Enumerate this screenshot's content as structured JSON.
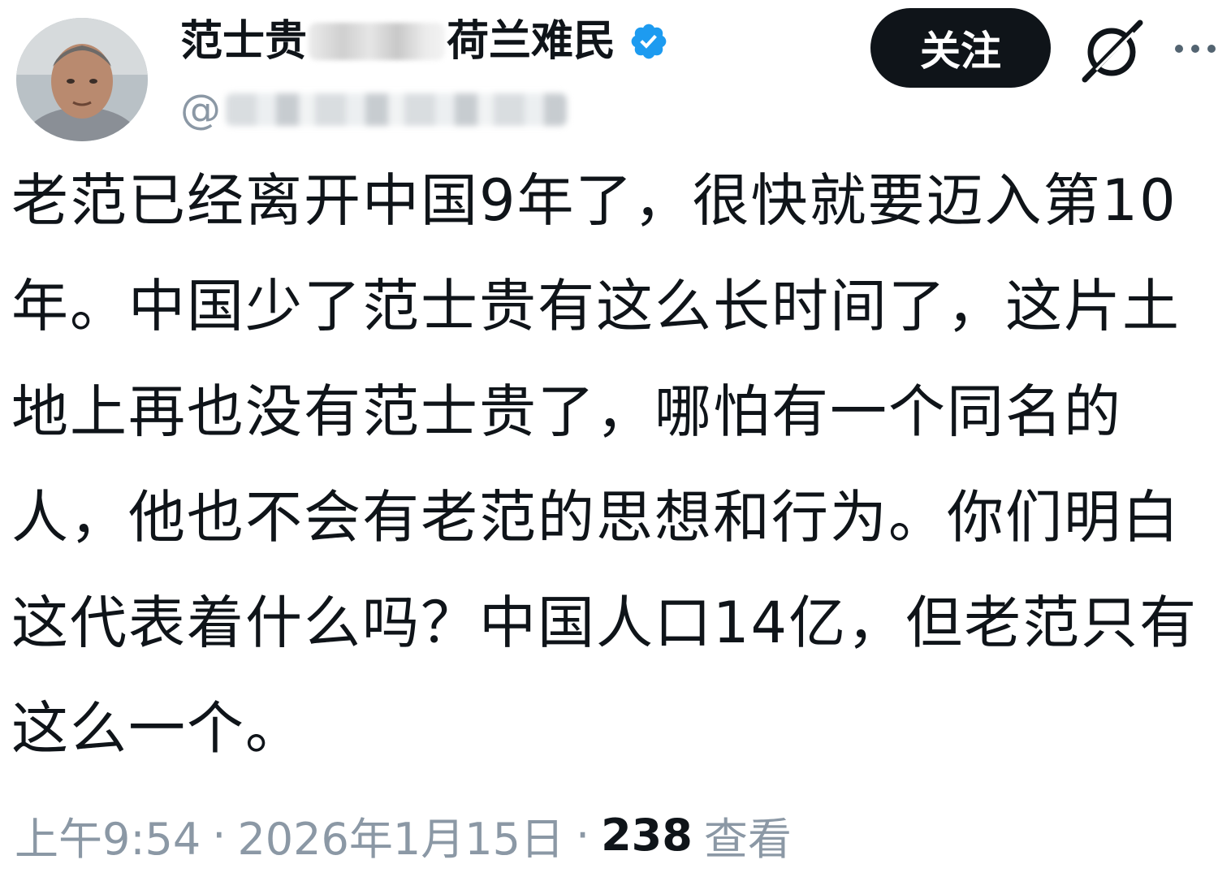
{
  "profile": {
    "avatar_icon": "user-photo-avatar",
    "name_prefix": "范士贵",
    "name_suffix": "荷兰难民",
    "verified_icon": "verified-badge-icon",
    "handle_at": "@"
  },
  "actions": {
    "follow_label": "关注",
    "grok_icon": "grok-icon",
    "more_icon": "more-options-icon"
  },
  "tweet": {
    "text": "老范已经离开中国9年了，很快就要迈入第10年。中国少了范士贵有这么长时间了，这片土地上再也没有范士贵了，哪怕有一个同名的人，他也不会有老范的思想和行为。你们明白这代表着什么吗？中国人口14亿，但老范只有这么一个。",
    "time": "上午9:54",
    "separator": "·",
    "date": "2026年1月15日",
    "views_count": "238",
    "views_label": "查看"
  },
  "colors": {
    "text_primary": "#0f1419",
    "text_secondary": "#8b98a5",
    "verified_blue": "#1d9bf0",
    "button_bg": "#0f1419"
  }
}
